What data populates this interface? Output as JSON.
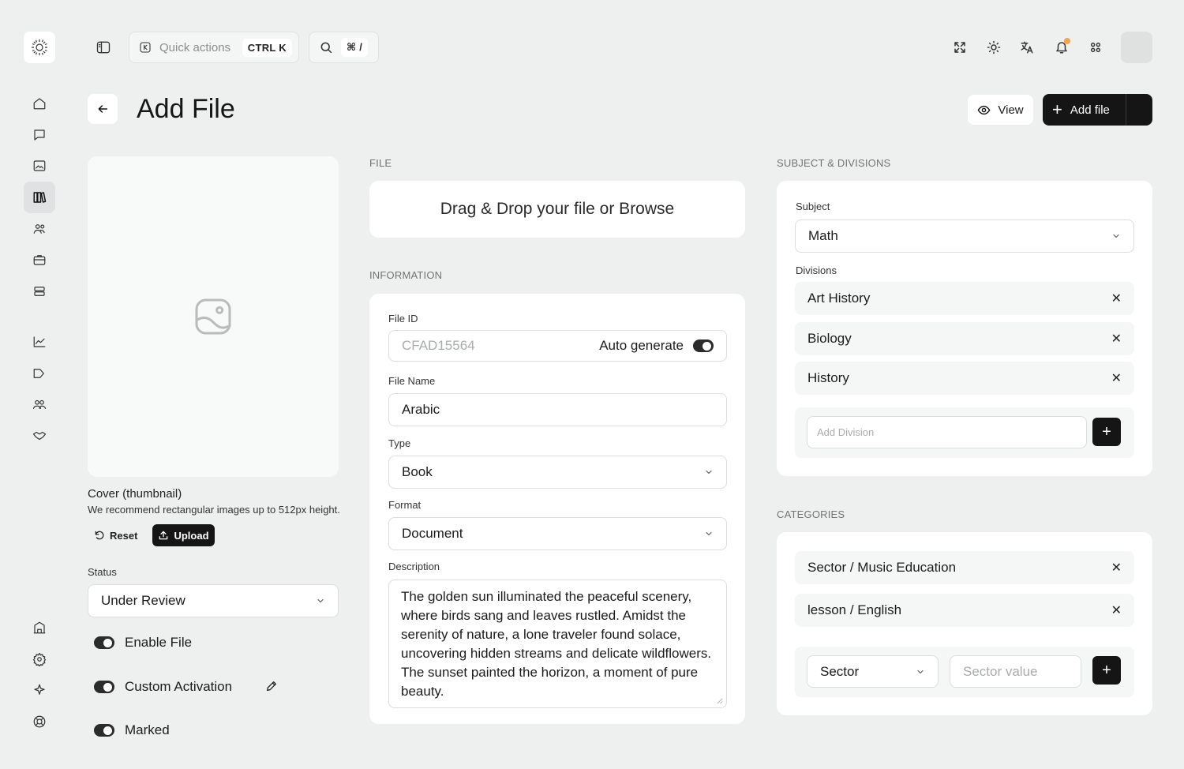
{
  "topbar": {
    "quick_actions_label": "Quick actions",
    "quick_actions_shortcut": "CTRL K",
    "search_shortcut": "⌘ /"
  },
  "header": {
    "title": "Add File",
    "view_label": "View",
    "add_file_label": "Add file"
  },
  "cover": {
    "title": "Cover (thumbnail)",
    "hint": "We recommend rectangular images up to 512px height.",
    "reset_label": "Reset",
    "upload_label": "Upload"
  },
  "status": {
    "label": "Status",
    "value": "Under Review"
  },
  "toggles": [
    {
      "label": "Enable File",
      "on": true
    },
    {
      "label": "Custom Activation",
      "on": true
    },
    {
      "label": "Marked",
      "on": true
    }
  ],
  "file_section": {
    "label": "FILE",
    "dropzone_text": "Drag & Drop your file or Browse"
  },
  "information": {
    "label": "INFORMATION",
    "file_id_label": "File ID",
    "file_id_placeholder": "CFAD15564",
    "auto_generate_label": "Auto generate",
    "file_name_label": "File Name",
    "file_name_value": "Arabic",
    "type_label": "Type",
    "type_value": "Book",
    "format_label": "Format",
    "format_value": "Document",
    "description_label": "Description",
    "description_value": "The golden sun illuminated the peaceful scenery, where birds sang and leaves rustled. Amidst the serenity of nature, a lone traveler found solace, uncovering hidden streams and delicate wildflowers. The sunset painted the horizon, a moment of pure beauty."
  },
  "subject_divisions": {
    "label": "SUBJECT & DIVISIONS",
    "subject_label": "Subject",
    "subject_value": "Math",
    "divisions_label": "Divisions",
    "divisions": [
      "Art History",
      "Biology",
      "History"
    ],
    "add_division_placeholder": "Add Division"
  },
  "categories": {
    "label": "CATEGORIES",
    "items": [
      "Sector / Music Education",
      "lesson / English"
    ],
    "sector_select_value": "Sector",
    "sector_value_placeholder": "Sector value"
  },
  "colors": {
    "background": "#eef0f0",
    "primary": "#151515",
    "notification_dot": "#f5a24a"
  }
}
